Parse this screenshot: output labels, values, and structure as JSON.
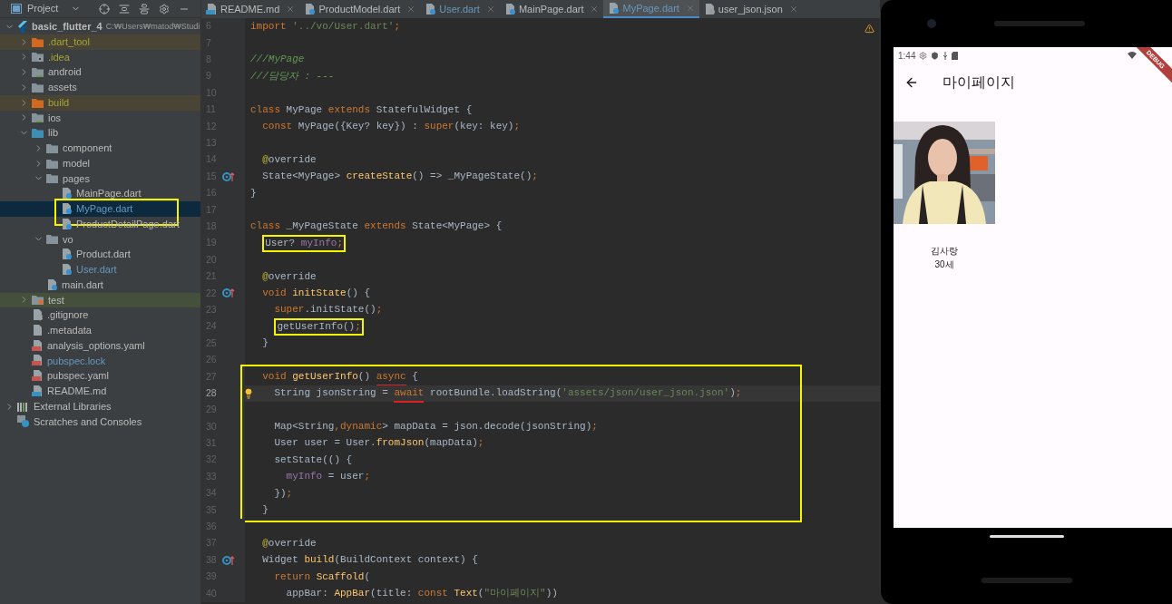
{
  "sidebar": {
    "title": "Project",
    "tree": [
      {
        "label": "basic_flutter_4",
        "path": "C:₩Users₩matod₩Studi",
        "kind": "project",
        "excluded": false,
        "ignored": false,
        "modified": false,
        "expanded": true,
        "selected": false,
        "children": [
          {
            "label": ".dart_tool",
            "kind": "folder_excluded",
            "excluded": true,
            "ignored": false,
            "modified": false,
            "expanded": false,
            "selected": false
          },
          {
            "label": ".idea",
            "kind": "folder_config",
            "excluded": false,
            "ignored": true,
            "modified": false,
            "expanded": false,
            "selected": false
          },
          {
            "label": "android",
            "kind": "folder_platform",
            "excluded": false,
            "ignored": false,
            "modified": false,
            "expanded": false,
            "selected": false
          },
          {
            "label": "assets",
            "kind": "folder",
            "excluded": false,
            "ignored": false,
            "modified": false,
            "expanded": false,
            "selected": false
          },
          {
            "label": "build",
            "kind": "folder_excluded",
            "excluded": true,
            "ignored": false,
            "modified": false,
            "expanded": false,
            "selected": false
          },
          {
            "label": "ios",
            "kind": "folder_platform",
            "excluded": false,
            "ignored": false,
            "modified": false,
            "expanded": false,
            "selected": false
          },
          {
            "label": "lib",
            "kind": "folder_source",
            "excluded": false,
            "ignored": false,
            "modified": false,
            "expanded": true,
            "selected": false,
            "children": [
              {
                "label": "component",
                "kind": "folder",
                "excluded": false,
                "ignored": false,
                "modified": false,
                "expanded": false,
                "selected": false
              },
              {
                "label": "model",
                "kind": "folder",
                "excluded": false,
                "ignored": false,
                "modified": false,
                "expanded": false,
                "selected": false
              },
              {
                "label": "pages",
                "kind": "folder",
                "excluded": false,
                "ignored": false,
                "modified": false,
                "expanded": true,
                "selected": false,
                "children": [
                  {
                    "label": "MainPage.dart",
                    "kind": "dart",
                    "excluded": false,
                    "ignored": false,
                    "modified": false,
                    "selected": false
                  },
                  {
                    "label": "MyPage.dart",
                    "kind": "dart",
                    "excluded": false,
                    "ignored": false,
                    "modified": true,
                    "selected": true,
                    "boxed": true
                  },
                  {
                    "label": "ProductDetailPage.dart",
                    "kind": "dart",
                    "excluded": false,
                    "ignored": false,
                    "modified": false,
                    "selected": false
                  }
                ]
              },
              {
                "label": "vo",
                "kind": "folder",
                "excluded": false,
                "ignored": false,
                "modified": false,
                "expanded": true,
                "selected": false,
                "children": [
                  {
                    "label": "Product.dart",
                    "kind": "dart",
                    "excluded": false,
                    "ignored": false,
                    "modified": false,
                    "selected": false
                  },
                  {
                    "label": "User.dart",
                    "kind": "dart",
                    "excluded": false,
                    "ignored": false,
                    "modified": true,
                    "selected": false
                  }
                ]
              },
              {
                "label": "main.dart",
                "kind": "dart",
                "excluded": false,
                "ignored": false,
                "modified": false,
                "selected": false
              }
            ]
          },
          {
            "label": "test",
            "kind": "folder_test",
            "excluded": false,
            "ignored": false,
            "modified": false,
            "expanded": false,
            "selected": false
          },
          {
            "label": ".gitignore",
            "kind": "gitignore",
            "excluded": false,
            "ignored": false,
            "modified": false,
            "selected": false
          },
          {
            "label": ".metadata",
            "kind": "text",
            "excluded": false,
            "ignored": false,
            "modified": false,
            "selected": false
          },
          {
            "label": "analysis_options.yaml",
            "kind": "yaml",
            "excluded": false,
            "ignored": false,
            "modified": false,
            "selected": false
          },
          {
            "label": "pubspec.lock",
            "kind": "yaml",
            "excluded": false,
            "ignored": false,
            "modified": true,
            "selected": false
          },
          {
            "label": "pubspec.yaml",
            "kind": "yaml",
            "excluded": false,
            "ignored": false,
            "modified": false,
            "selected": false
          },
          {
            "label": "README.md",
            "kind": "md",
            "excluded": false,
            "ignored": false,
            "modified": false,
            "selected": false
          }
        ]
      },
      {
        "label": "External Libraries",
        "kind": "libraries",
        "excluded": false,
        "ignored": false,
        "modified": false,
        "expanded": false,
        "selected": false
      },
      {
        "label": "Scratches and Consoles",
        "kind": "scratches",
        "excluded": false,
        "ignored": false,
        "modified": false,
        "selected": false
      }
    ]
  },
  "tabs": [
    {
      "label": "README.md",
      "kind": "md",
      "modified": false,
      "selected": false
    },
    {
      "label": "ProductModel.dart",
      "kind": "dart",
      "modified": false,
      "selected": false
    },
    {
      "label": "User.dart",
      "kind": "dart",
      "modified": true,
      "selected": false
    },
    {
      "label": "MainPage.dart",
      "kind": "dart",
      "modified": false,
      "selected": false
    },
    {
      "label": "MyPage.dart",
      "kind": "dart",
      "modified": true,
      "selected": true
    },
    {
      "label": "user_json.json",
      "kind": "json",
      "modified": false,
      "selected": false
    }
  ],
  "editor": {
    "lines": [
      {
        "no": "6",
        "tokens": [
          {
            "kind": "kw",
            "text": "import "
          },
          {
            "kind": "str",
            "text": "'../vo/User.dart'"
          },
          {
            "kind": "kw",
            "text": ";"
          }
        ]
      },
      {
        "no": "7"
      },
      {
        "no": "8",
        "tokens": [
          {
            "kind": "comment",
            "text": "///MyPage"
          }
        ]
      },
      {
        "no": "9",
        "tokens": [
          {
            "kind": "comment",
            "text": "///담당자 : ---"
          }
        ]
      },
      {
        "no": "10"
      },
      {
        "no": "11",
        "tokens": [
          {
            "kind": "kw",
            "text": "class "
          },
          {
            "kind": "plain",
            "text": "MyPage "
          },
          {
            "kind": "kw",
            "text": "extends "
          },
          {
            "kind": "plain",
            "text": "StatefulWidget {"
          }
        ]
      },
      {
        "no": "12",
        "tokens": [
          {
            "kind": "kw",
            "text": "  const "
          },
          {
            "kind": "plain",
            "text": "MyPage({Key? key}) : "
          },
          {
            "kind": "kw",
            "text": "super"
          },
          {
            "kind": "plain",
            "text": "(key: key)"
          },
          {
            "kind": "kw",
            "text": ";"
          }
        ]
      },
      {
        "no": "13"
      },
      {
        "no": "14",
        "tokens": [
          {
            "kind": "annotation",
            "text": "  @"
          },
          {
            "kind": "plain",
            "text": "override"
          }
        ]
      },
      {
        "no": "15",
        "overrides": true,
        "tokens": [
          {
            "kind": "plain",
            "text": "  State<MyPage> "
          },
          {
            "kind": "fn",
            "text": "createState"
          },
          {
            "kind": "plain",
            "text": "() => _MyPageState()"
          },
          {
            "kind": "kw",
            "text": ";"
          }
        ]
      },
      {
        "no": "16",
        "tokens": [
          {
            "kind": "plain",
            "text": "}"
          }
        ]
      },
      {
        "no": "17"
      },
      {
        "no": "18",
        "tokens": [
          {
            "kind": "kw",
            "text": "class "
          },
          {
            "kind": "plain",
            "text": "_MyPageState "
          },
          {
            "kind": "kw",
            "text": "extends "
          },
          {
            "kind": "plain",
            "text": "State<MyPage> {"
          }
        ]
      },
      {
        "no": "19",
        "boxed": true,
        "tokens": [
          {
            "kind": "plain",
            "text": "  User? "
          },
          {
            "kind": "field",
            "text": "myInfo"
          },
          {
            "kind": "kw",
            "text": ";"
          }
        ]
      },
      {
        "no": "20"
      },
      {
        "no": "21",
        "tokens": [
          {
            "kind": "annotation",
            "text": "  @"
          },
          {
            "kind": "plain",
            "text": "override"
          }
        ]
      },
      {
        "no": "22",
        "overrides": true,
        "tokens": [
          {
            "kind": "kw",
            "text": "  void "
          },
          {
            "kind": "fn",
            "text": "initState"
          },
          {
            "kind": "plain",
            "text": "() {"
          }
        ]
      },
      {
        "no": "23",
        "tokens": [
          {
            "kind": "kw",
            "text": "    super"
          },
          {
            "kind": "plain",
            "text": ".initState()"
          },
          {
            "kind": "kw",
            "text": ";"
          }
        ]
      },
      {
        "no": "24",
        "boxed": true,
        "tokens": [
          {
            "kind": "plain",
            "text": "    getUserInfo()"
          },
          {
            "kind": "kw",
            "text": ";"
          }
        ]
      },
      {
        "no": "25",
        "tokens": [
          {
            "kind": "plain",
            "text": "  }"
          }
        ]
      },
      {
        "no": "26"
      },
      {
        "no": "27",
        "in_box": true,
        "tokens": [
          {
            "kind": "kw",
            "text": "  void "
          },
          {
            "kind": "fn",
            "text": "getUserInfo"
          },
          {
            "kind": "plain",
            "text": "() "
          },
          {
            "kind": "kw",
            "text": "async",
            "underlined": true
          },
          {
            "kind": "plain",
            "text": " {"
          }
        ]
      },
      {
        "no": "28",
        "in_box": true,
        "current": true,
        "has_intention": true,
        "tokens": [
          {
            "kind": "plain",
            "text": "    String jsonString = "
          },
          {
            "kind": "kw",
            "text": "await",
            "underlined": true
          },
          {
            "kind": "plain",
            "text": " rootBundle.loadString("
          },
          {
            "kind": "str",
            "text": "'assets/json/user_json.json'"
          },
          {
            "kind": "plain",
            "text": ")"
          },
          {
            "kind": "kw",
            "text": ";"
          }
        ]
      },
      {
        "no": "29",
        "in_box": true
      },
      {
        "no": "30",
        "in_box": true,
        "tokens": [
          {
            "kind": "plain",
            "text": "    Map<String"
          },
          {
            "kind": "kw",
            "text": ",dynamic"
          },
          {
            "kind": "plain",
            "text": "> mapData = json.decode(jsonString)"
          },
          {
            "kind": "kw",
            "text": ";"
          }
        ]
      },
      {
        "no": "31",
        "in_box": true,
        "tokens": [
          {
            "kind": "plain",
            "text": "    User user = User."
          },
          {
            "kind": "fn",
            "text": "fromJson"
          },
          {
            "kind": "plain",
            "text": "(mapData)"
          },
          {
            "kind": "kw",
            "text": ";"
          }
        ]
      },
      {
        "no": "32",
        "in_box": true,
        "tokens": [
          {
            "kind": "plain",
            "text": "    setState(() {"
          }
        ]
      },
      {
        "no": "33",
        "in_box": true,
        "tokens": [
          {
            "kind": "field",
            "text": "      myInfo"
          },
          {
            "kind": "plain",
            "text": " = user"
          },
          {
            "kind": "kw",
            "text": ";"
          }
        ]
      },
      {
        "no": "34",
        "in_box": true,
        "tokens": [
          {
            "kind": "plain",
            "text": "    })"
          },
          {
            "kind": "kw",
            "text": ";"
          }
        ]
      },
      {
        "no": "35",
        "in_box": true,
        "tokens": [
          {
            "kind": "plain",
            "text": "  }"
          }
        ]
      },
      {
        "no": "36"
      },
      {
        "no": "37",
        "tokens": [
          {
            "kind": "annotation",
            "text": "  @"
          },
          {
            "kind": "plain",
            "text": "override"
          }
        ]
      },
      {
        "no": "38",
        "overrides": true,
        "tokens": [
          {
            "kind": "plain",
            "text": "  Widget "
          },
          {
            "kind": "fn",
            "text": "build"
          },
          {
            "kind": "plain",
            "text": "(BuildContext context) {"
          }
        ]
      },
      {
        "no": "39",
        "tokens": [
          {
            "kind": "kw",
            "text": "    return "
          },
          {
            "kind": "fn",
            "text": "Scaffold"
          },
          {
            "kind": "plain",
            "text": "("
          }
        ]
      },
      {
        "no": "40",
        "tokens": [
          {
            "kind": "plain",
            "text": "      appBar: "
          },
          {
            "kind": "fn",
            "text": "AppBar"
          },
          {
            "kind": "plain",
            "text": "(title: "
          },
          {
            "kind": "kw",
            "text": "const "
          },
          {
            "kind": "fn",
            "text": "Text"
          },
          {
            "kind": "plain",
            "text": "("
          },
          {
            "kind": "str",
            "text": "\"마이페이지\""
          },
          {
            "kind": "plain",
            "text": "))"
          }
        ]
      }
    ]
  },
  "phone": {
    "time": "1:44",
    "banner": "DEBUG",
    "app_bar": {
      "title": "마이페이지"
    },
    "profile": {
      "name": "김사랑",
      "age": "30세"
    }
  }
}
